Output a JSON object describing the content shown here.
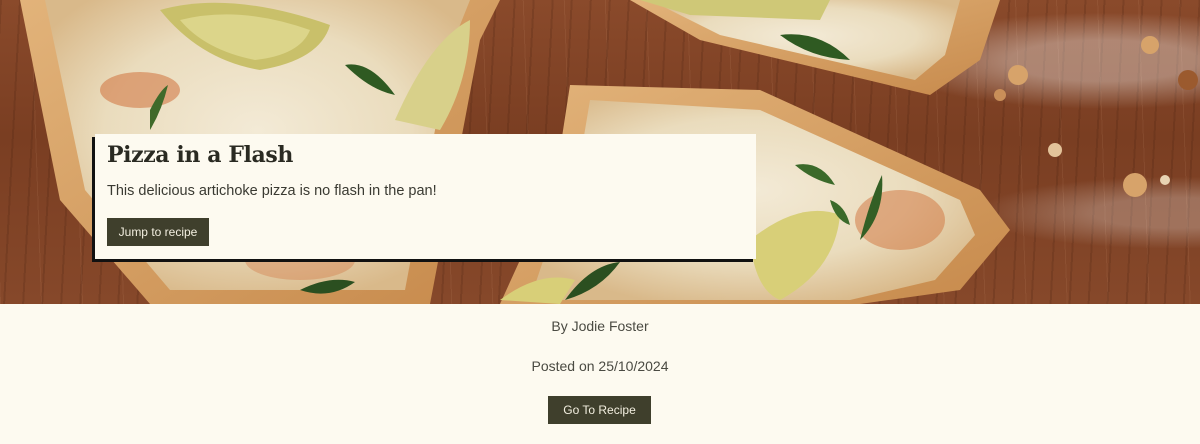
{
  "hero": {
    "image_description": "Artichoke pizza slices on a floured wooden board"
  },
  "card": {
    "title": "Pizza in a Flash",
    "description": "This delicious artichoke pizza is no flash in the pan!",
    "button_label": "Jump to recipe"
  },
  "meta": {
    "author": "By Jodie Foster",
    "posted": "Posted on 25/10/2024",
    "button_label": "Go To Recipe"
  },
  "colors": {
    "background": "#fdfaf0",
    "button": "#3f3f2c",
    "button_text": "#f3efe0",
    "text": "#3a3a32"
  }
}
